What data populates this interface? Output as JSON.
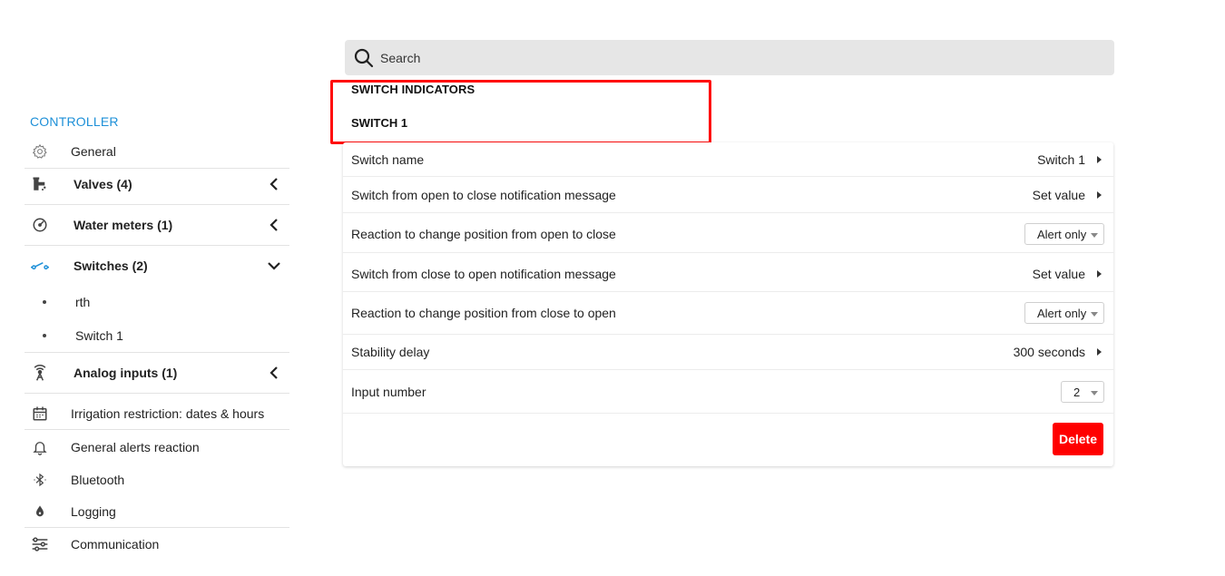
{
  "search": {
    "placeholder": "Search"
  },
  "breadcrumb": {
    "level1": "SWITCH INDICATORS",
    "level2": "SWITCH 1"
  },
  "sidebar": {
    "title": "CONTROLLER",
    "items": [
      {
        "label": "General",
        "icon": "gear-icon"
      },
      {
        "label": "Valves (4)",
        "icon": "valve-icon",
        "expanded": false
      },
      {
        "label": "Water meters (1)",
        "icon": "gauge-icon",
        "expanded": false
      },
      {
        "label": "Switches (2)",
        "icon": "switch-icon",
        "expanded": true,
        "children": [
          {
            "label": "rth"
          },
          {
            "label": "Switch 1"
          }
        ]
      },
      {
        "label": "Analog inputs (1)",
        "icon": "antenna-icon",
        "expanded": false
      },
      {
        "label": "Irrigation restriction: dates & hours",
        "icon": "calendar-icon"
      },
      {
        "label": "General alerts reaction",
        "icon": "bell-icon"
      },
      {
        "label": "Bluetooth",
        "icon": "bluetooth-icon"
      },
      {
        "label": "Logging",
        "icon": "drop-icon"
      },
      {
        "label": "Communication",
        "icon": "sliders-icon"
      }
    ],
    "accent_color": "#1e90d8"
  },
  "settings": {
    "rows": [
      {
        "label": "Switch name",
        "value": "Switch 1",
        "type": "link"
      },
      {
        "label": "Switch from open to close notification message",
        "value": "Set value",
        "type": "link"
      },
      {
        "label": "Reaction to change position from open to close",
        "value": "Alert only",
        "type": "select"
      },
      {
        "label": "Switch from close to open notification message",
        "value": "Set value",
        "type": "link"
      },
      {
        "label": "Reaction to change position from close to open",
        "value": "Alert only",
        "type": "select"
      },
      {
        "label": "Stability delay",
        "value": "300 seconds",
        "type": "link"
      },
      {
        "label": "Input number",
        "value": "2",
        "type": "select"
      }
    ],
    "delete_label": "Delete",
    "delete_color": "#ff0000"
  },
  "highlight_color": "#ff0d0d"
}
